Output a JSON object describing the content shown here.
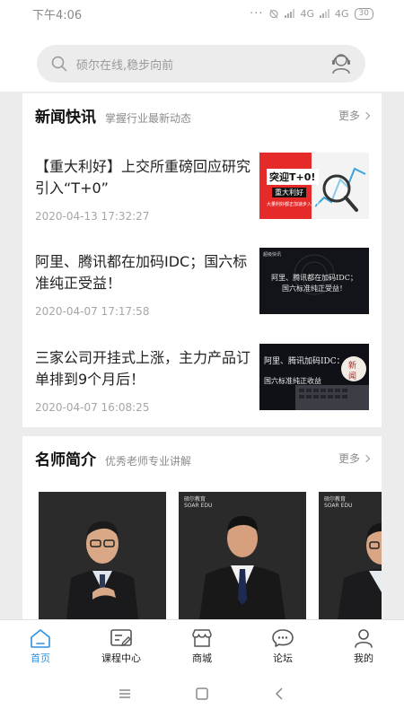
{
  "status": {
    "time": "下午4:06",
    "network1": "4G",
    "network2": "4G",
    "battery": "30"
  },
  "search": {
    "placeholder": "硕尔在线,稳步向前"
  },
  "news": {
    "title": "新闻快讯",
    "subtitle": "掌握行业最新动态",
    "more": "更多",
    "items": [
      {
        "title": "【重大利好】上交所重磅回应研究引入“T+0”",
        "date": "2020-04-13 17:32:27",
        "thumb": {
          "line1": "突迎T+0!",
          "line2": "重大利好",
          "line3": "大量利好都正加速步入增长"
        }
      },
      {
        "title": "阿里、腾讯都在加码IDC；国六标准纯正受益！",
        "date": "2020-04-07 17:17:58",
        "thumb": {
          "tag": "超级快讯",
          "line1": "阿里、腾讯都在加码IDC；",
          "line2": "国六标准纯正受益！"
        }
      },
      {
        "title": "三家公司开挂式上涨，主力产品订单排到9个月后！",
        "date": "2020-04-07 16:08:25",
        "thumb": {
          "line1": "阿里、腾讯加码IDC：",
          "line2": "国六标准纯正收益",
          "seal1": "新",
          "seal2": "闻"
        }
      }
    ]
  },
  "teachers": {
    "title": "名师简介",
    "subtitle": "优秀老师专业讲解",
    "more": "更多",
    "brand_cn": "硕尔教育",
    "brand_en": "SOAR EDU"
  },
  "nav": {
    "items": [
      {
        "label": "首页"
      },
      {
        "label": "课程中心"
      },
      {
        "label": "商城"
      },
      {
        "label": "论坛"
      },
      {
        "label": "我的"
      }
    ]
  },
  "colors": {
    "accent": "#2f8fe0",
    "thumb_red": "#e52a2a"
  }
}
